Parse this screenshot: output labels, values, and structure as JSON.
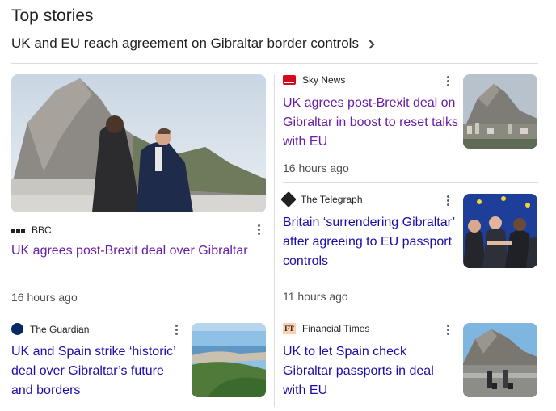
{
  "section": {
    "title": "Top stories"
  },
  "lead_headline": {
    "text": "UK and EU reach agreement on Gibraltar border controls"
  },
  "stories": [
    {
      "source": "BBC",
      "logo_icon": "bbc-logo-icon",
      "title": "UK agrees post-Brexit deal over Gibraltar",
      "time": "16 hours ago",
      "visited": true
    },
    {
      "source": "Sky News",
      "logo_icon": "sky-news-logo-icon",
      "title": "UK agrees post-Brexit deal on Gibraltar in boost to reset talks with EU",
      "time": "16 hours ago",
      "visited": true
    },
    {
      "source": "The Telegraph",
      "logo_icon": "telegraph-logo-icon",
      "title": "Britain ‘surrendering Gibraltar’ after agreeing to EU passport controls",
      "time": "11 hours ago",
      "visited": false
    },
    {
      "source": "The Guardian",
      "logo_icon": "guardian-logo-icon",
      "title": "UK and Spain strike ‘historic’ deal over Gibraltar’s future and borders",
      "time": "",
      "visited": false
    },
    {
      "source": "Financial Times",
      "logo_icon": "ft-logo-icon",
      "logo_text": "FT",
      "title": "UK to let Spain check Gibraltar passports in deal with EU",
      "time": "",
      "visited": false
    }
  ],
  "colors": {
    "visited_link": "#681da8",
    "link": "#1a0dab",
    "divider": "#dadce0"
  }
}
